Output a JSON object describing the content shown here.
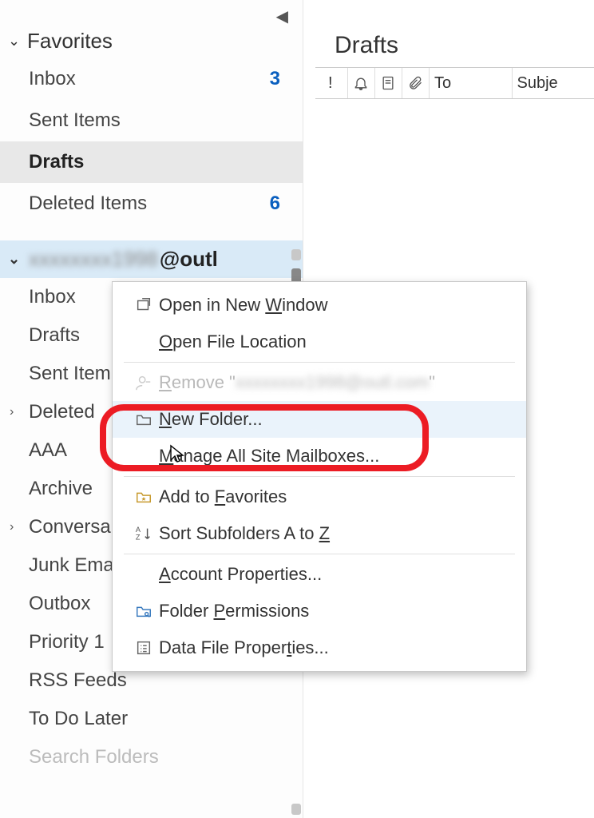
{
  "nav": {
    "favorites_label": "Favorites",
    "folders": [
      {
        "label": "Inbox",
        "count": "3",
        "selected": false
      },
      {
        "label": "Sent Items",
        "count": "",
        "selected": false
      },
      {
        "label": "Drafts",
        "count": "",
        "selected": true
      },
      {
        "label": "Deleted Items",
        "count": "6",
        "selected": false
      }
    ],
    "account": {
      "blurred_part": "xxxxxxxx1998",
      "visible_part": "@outl"
    },
    "sub_folders": [
      {
        "label": "Inbox",
        "expandable": false
      },
      {
        "label": "Drafts",
        "expandable": false
      },
      {
        "label": "Sent Item",
        "expandable": false
      },
      {
        "label": "Deleted",
        "expandable": true
      },
      {
        "label": "AAA",
        "expandable": false
      },
      {
        "label": "Archive",
        "expandable": false
      },
      {
        "label": "Conversa",
        "expandable": true
      },
      {
        "label": "Junk Ema",
        "expandable": false
      },
      {
        "label": "Outbox",
        "expandable": false
      },
      {
        "label": "Priority 1",
        "expandable": false
      },
      {
        "label": "RSS Feeds",
        "expandable": false
      },
      {
        "label": "To Do Later",
        "expandable": false
      },
      {
        "label": "Search Folders",
        "expandable": false
      }
    ]
  },
  "main": {
    "title": "Drafts",
    "columns": {
      "importance": "!",
      "to": "To",
      "subject": "Subje"
    }
  },
  "context_menu": {
    "open_new_window": "Open in New Window",
    "open_file_location": "Open File Location",
    "remove_prefix": "Remove \"",
    "remove_blur": "xxxxxxxx1998@outl.com",
    "remove_suffix": "\"",
    "new_folder": "New Folder...",
    "manage_mailboxes": "Manage All Site Mailboxes...",
    "add_favorites": "Add to Favorites",
    "sort_subfolders": "Sort Subfolders A to Z",
    "account_properties": "Account Properties...",
    "folder_permissions": "Folder Permissions",
    "data_file_properties": "Data File Properties..."
  }
}
